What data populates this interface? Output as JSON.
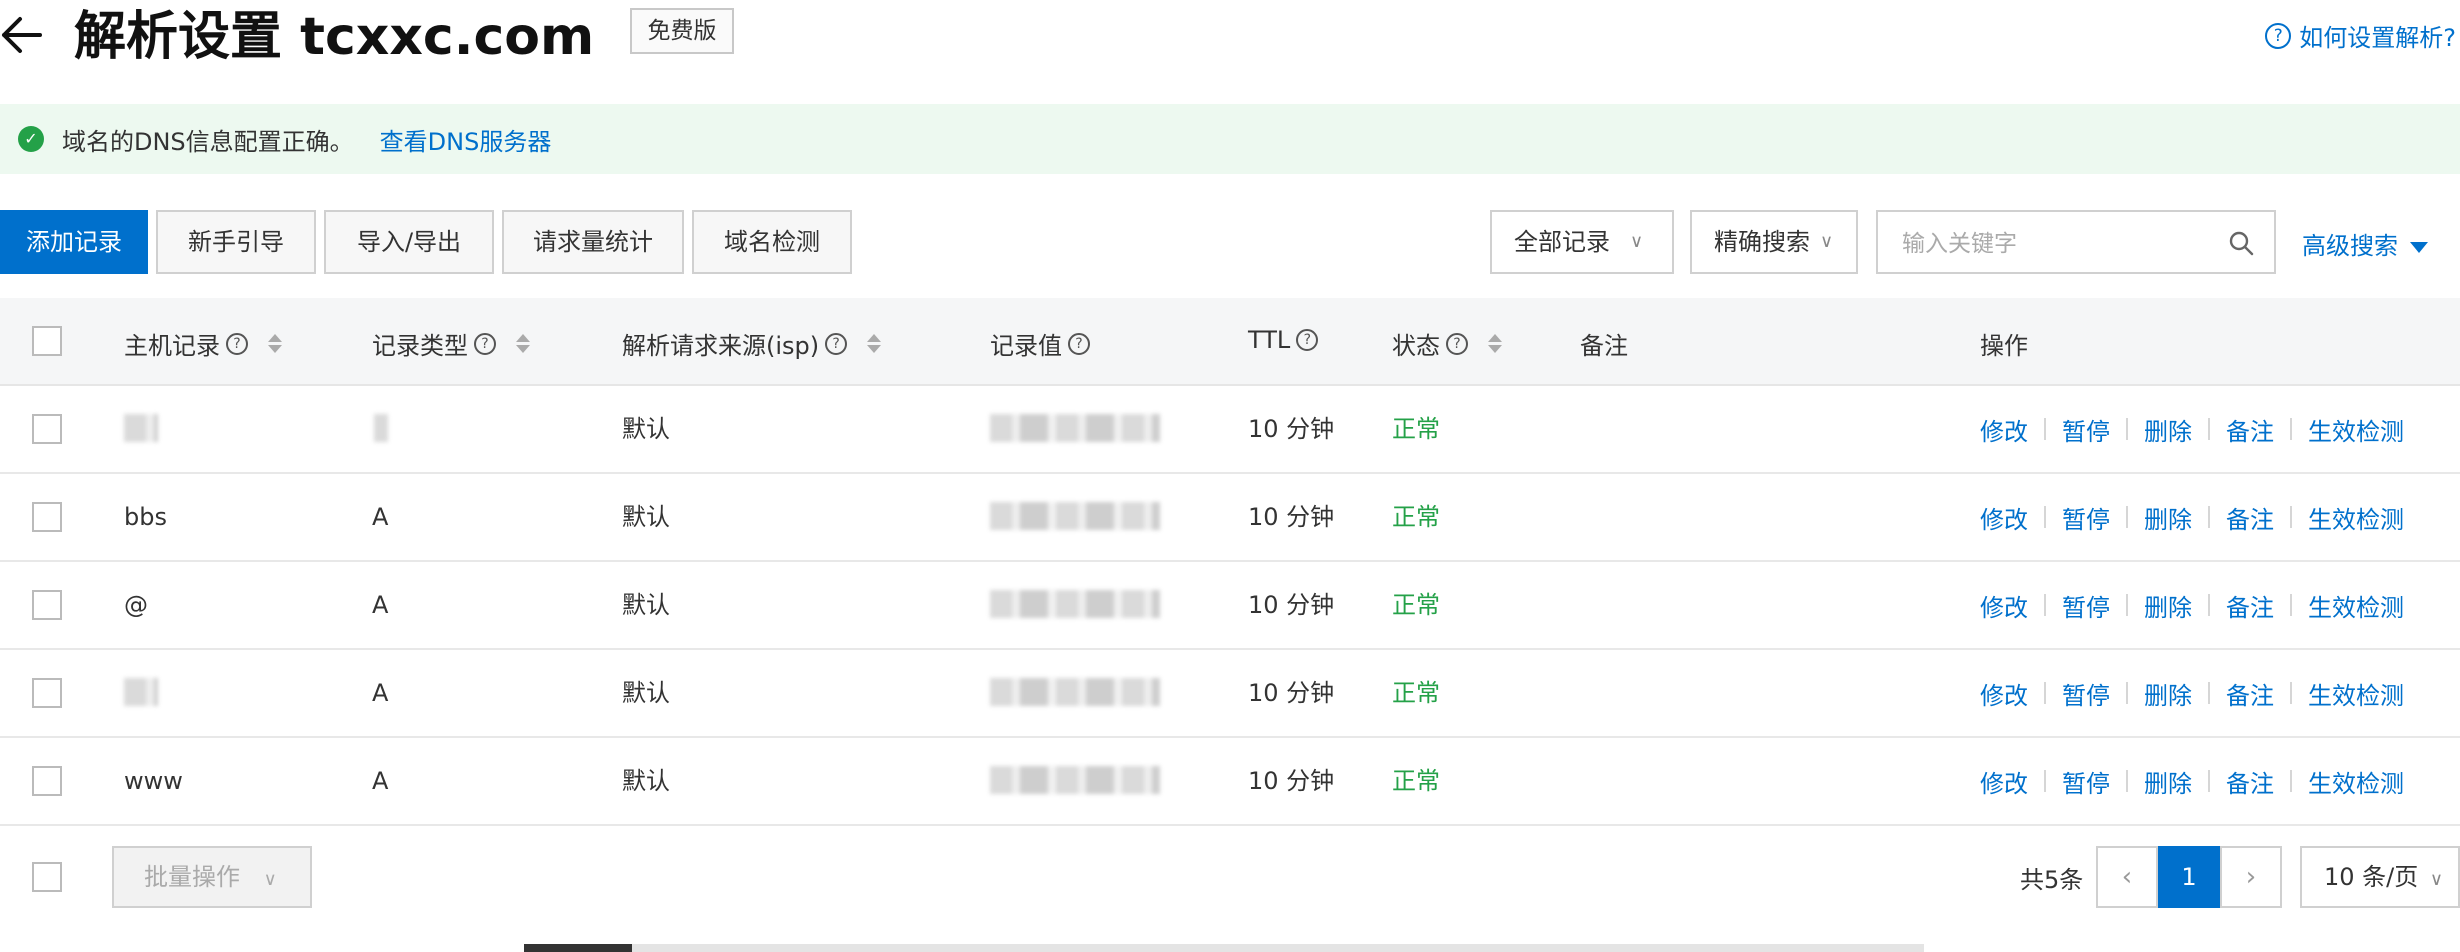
{
  "header": {
    "title": "解析设置 tcxxc.com",
    "plan_badge": "免费版",
    "help_link": "如何设置解析?",
    "help_icon_glyph": "?"
  },
  "alert": {
    "message": "域名的DNS信息配置正确。",
    "link": "查看DNS服务器"
  },
  "toolbar": {
    "buttons": [
      "添加记录",
      "新手引导",
      "导入/导出",
      "请求量统计",
      "域名检测"
    ],
    "filter_select": "全部记录",
    "search_mode_select": "精确搜索",
    "search_placeholder": "输入关键字",
    "advanced_search": "高级搜索"
  },
  "table": {
    "columns": [
      "主机记录",
      "记录类型",
      "解析请求来源(isp)",
      "记录值",
      "TTL",
      "状态",
      "备注",
      "操作"
    ],
    "rows": [
      {
        "host": "",
        "type": "",
        "isp": "默认",
        "value": "",
        "ttl": "10 分钟",
        "status": "正常",
        "note": ""
      },
      {
        "host": "bbs",
        "type": "A",
        "isp": "默认",
        "value": "",
        "ttl": "10 分钟",
        "status": "正常",
        "note": ""
      },
      {
        "host": "@",
        "type": "A",
        "isp": "默认",
        "value": "",
        "ttl": "10 分钟",
        "status": "正常",
        "note": ""
      },
      {
        "host": "",
        "type": "A",
        "isp": "默认",
        "value": "",
        "ttl": "10 分钟",
        "status": "正常",
        "note": ""
      },
      {
        "host": "www",
        "type": "A",
        "isp": "默认",
        "value": "",
        "ttl": "10 分钟",
        "status": "正常",
        "note": ""
      }
    ],
    "actions": [
      "修改",
      "暂停",
      "删除",
      "备注",
      "生效检测"
    ]
  },
  "footer": {
    "batch_button": "批量操作",
    "total": "共5条",
    "current_page": "1",
    "page_size": "10 条/页"
  },
  "colors": {
    "primary": "#0070cc",
    "success": "#24a148",
    "alert_bg": "#edf9f0"
  },
  "icons": {
    "back": "arrow-left-icon",
    "help": "question-circle-icon",
    "alert": "check-circle-icon",
    "search": "search-icon",
    "advanced": "caret-down-icon",
    "sort": "sort-icon"
  }
}
